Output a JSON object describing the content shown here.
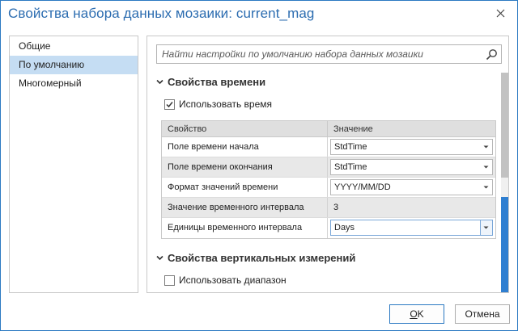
{
  "window": {
    "title": "Свойства набора данных мозаики: current_mag"
  },
  "nav": {
    "items": [
      {
        "label": "Общие",
        "selected": false
      },
      {
        "label": "По умолчанию",
        "selected": true
      },
      {
        "label": "Многомерный",
        "selected": false
      }
    ]
  },
  "search": {
    "placeholder": "Найти настройки по умолчанию набора данных мозаики"
  },
  "time_section": {
    "title": "Свойства времени",
    "use_time_label": "Использовать время",
    "use_time_checked": true,
    "grid": {
      "headers": [
        "Свойство",
        "Значение"
      ],
      "rows": [
        {
          "property": "Поле времени начала",
          "value": "StdTime",
          "kind": "combo"
        },
        {
          "property": "Поле времени окончания",
          "value": "StdTime",
          "kind": "combo"
        },
        {
          "property": "Формат значений времени",
          "value": "YYYY/MM/DD",
          "kind": "combo"
        },
        {
          "property": "Значение временного интервала",
          "value": "3",
          "kind": "static"
        },
        {
          "property": "Единицы временного интервала",
          "value": "Days",
          "kind": "combo-active"
        }
      ]
    }
  },
  "vertical_section": {
    "title": "Свойства вертикальных измерений",
    "use_range_label": "Использовать диапазон",
    "use_range_checked": false
  },
  "buttons": {
    "ok_label": "OK",
    "ok_underline_char": "O",
    "ok_rest": "K",
    "cancel_label": "Отмена"
  },
  "icons": {
    "close": "close-icon",
    "search": "search-icon",
    "chevron": "chevron-down-icon",
    "checkmark": "checkmark-icon",
    "dropdown": "dropdown-arrow-icon"
  },
  "colors": {
    "accent": "#2b79c2",
    "title": "#2b6cb0",
    "selected_nav": "#c5ddf3",
    "grid_header": "#dfdfdf",
    "grid_alt_row": "#e8e8e8",
    "scroll_active": "#2f7fd1"
  }
}
